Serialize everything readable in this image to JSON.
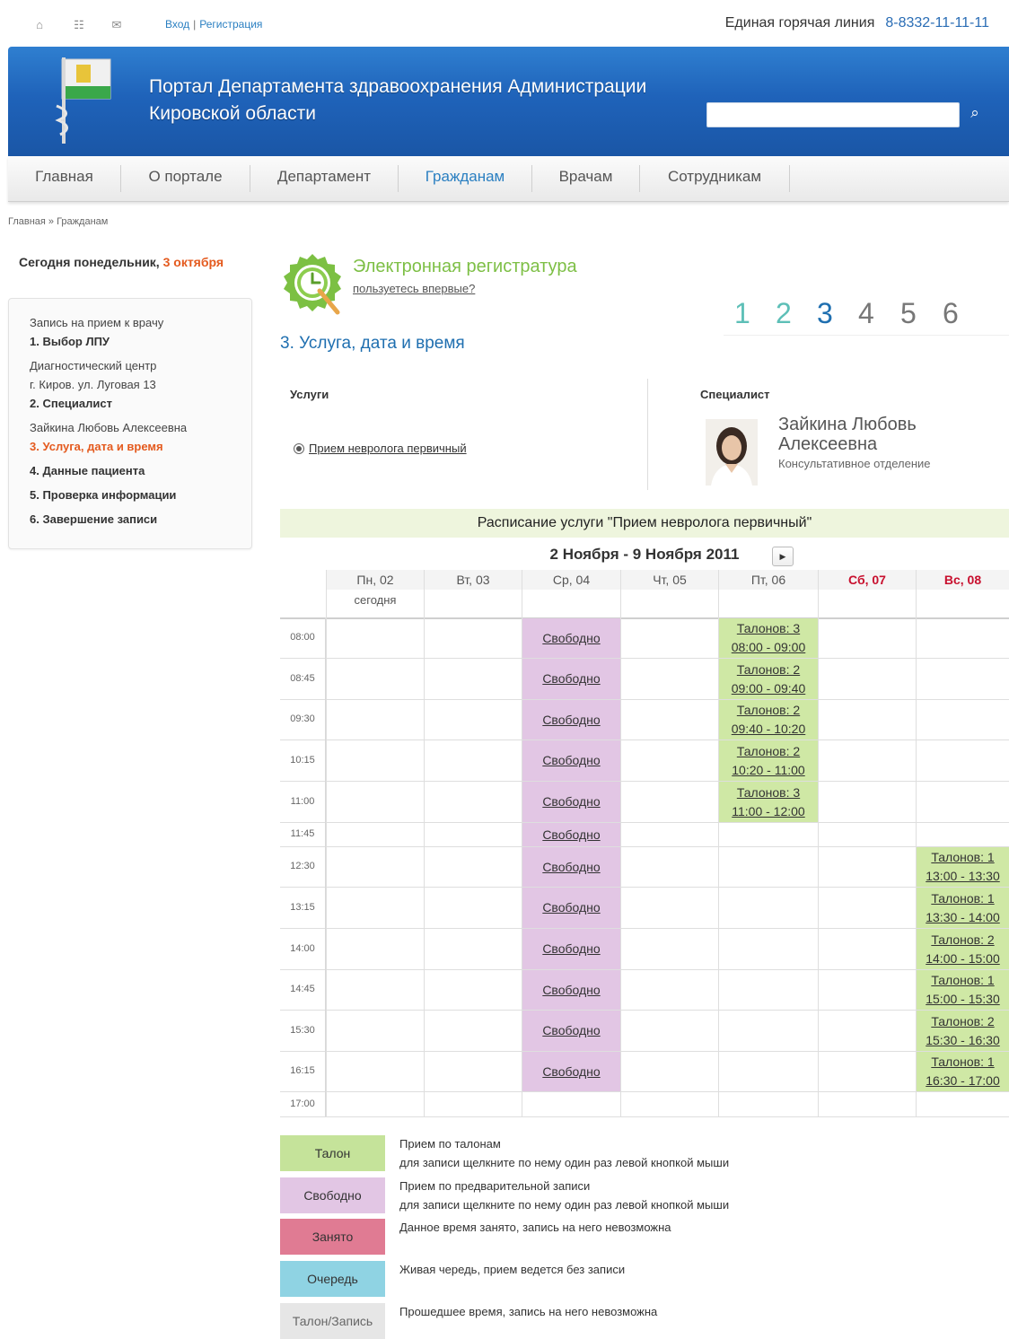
{
  "topbar": {
    "login": "Вход",
    "separator": "|",
    "register": "Регистрация",
    "hotline_label": "Единая горячая линия",
    "hotline_number": "8-8332-11-11-11"
  },
  "header": {
    "title_line1": "Портал Департамента здравоохранения Администрации",
    "title_line2": "Кировской области",
    "search_placeholder": ""
  },
  "nav": [
    "Главная",
    "О портале",
    "Департамент",
    "Гражданам",
    "Врачам",
    "Сотрудникам"
  ],
  "breadcrumb": "Главная » Гражданам",
  "sidebar": {
    "today_prefix": "Сегодня понедельник,",
    "today_date": "3 октября",
    "lines": [
      "Запись на прием к врачу",
      "1. Выбор ЛПУ",
      "Диагностический центр",
      "г. Киров. ул. Луговая 13",
      "2. Специалист",
      "Зайкина Любовь Алексеевна",
      "3. Услуга, дата и время",
      "4. Данные пациента",
      "5. Проверка информации",
      "6. Завершение записи"
    ]
  },
  "registry": {
    "title": "Электронная регистратура",
    "first_time_link": "пользуетесь впервые?",
    "steps": [
      "1",
      "2",
      "3",
      "4",
      "5",
      "6"
    ],
    "current_step": 3,
    "section_title": "3. Услуга, дата и время",
    "services_label": "Услуги",
    "service": "Прием невролога первичный",
    "specialist_label": "Специалист",
    "specialist_name_line1": "Зайкина Любовь",
    "specialist_name_line2": "Алексеевна",
    "specialist_dept": "Консультативное отделение"
  },
  "schedule": {
    "title": "Расписание услуги \"Прием невролога первичный\"",
    "week": "2 Ноября - 9 Ноября 2011",
    "days": [
      "Пн, 02",
      "Вт, 03",
      "Ср, 04",
      "Чт, 05",
      "Пт, 06",
      "Сб, 07",
      "Вс, 08"
    ],
    "today_label": "сегодня",
    "times": [
      "08:00",
      "08:45",
      "09:30",
      "10:15",
      "11:00",
      "11:45",
      "12:30",
      "13:15",
      "14:00",
      "14:45",
      "15:30",
      "16:15",
      "17:00"
    ],
    "free_label": "Свободно",
    "friday_slots": [
      {
        "tickets": "Талонов: 3",
        "time": "08:00 - 09:00"
      },
      {
        "tickets": "Талонов: 2",
        "time": "09:00 - 09:40"
      },
      {
        "tickets": "Талонов: 2",
        "time": "09:40 - 10:20"
      },
      {
        "tickets": "Талонов: 2",
        "time": "10:20 - 11:00"
      },
      {
        "tickets": "Талонов: 3",
        "time": "11:00 - 12:00"
      }
    ],
    "sunday_slots": [
      {
        "tickets": "Талонов: 1",
        "time": "13:00 - 13:30"
      },
      {
        "tickets": "Талонов: 1",
        "time": "13:30 - 14:00"
      },
      {
        "tickets": "Талонов: 2",
        "time": "14:00 - 15:00"
      },
      {
        "tickets": "Талонов: 1",
        "time": "15:00 - 15:30"
      },
      {
        "tickets": "Талонов: 2",
        "time": "15:30 - 16:30"
      },
      {
        "tickets": "Талонов: 1",
        "time": "16:30 - 17:00"
      }
    ]
  },
  "legend": [
    {
      "label": "Талон",
      "color": "#c5e39a",
      "text1": "Прием по талонам",
      "text2": "для записи щелкните по нему один раз левой кнопкой мыши"
    },
    {
      "label": "Свободно",
      "color": "#e2c6e4",
      "text1": "Прием по предварительной записи",
      "text2": "для записи щелкните по нему один раз левой кнопкой мыши"
    },
    {
      "label": "Занято",
      "color": "#e07b93",
      "text1": "Данное время занято, запись на него невозможна",
      "text2": ""
    },
    {
      "label": "Очередь",
      "color": "#8fd3e3",
      "text1": "Живая чередь, прием ведется без записи",
      "text2": ""
    },
    {
      "label": "Талон/Запись",
      "color": "#e6e6e6",
      "text1": "Прошедшее время, запись на него невозможна",
      "text2": ""
    }
  ]
}
